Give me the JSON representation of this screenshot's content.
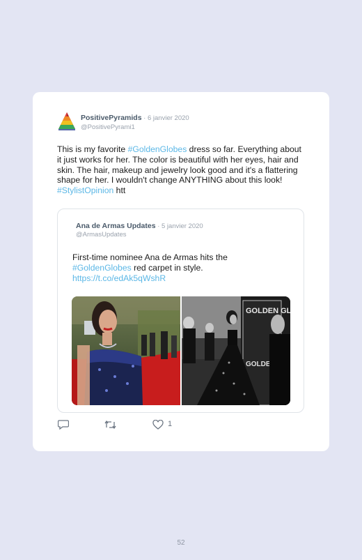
{
  "tweet": {
    "author_name": "PositivePyramids",
    "date": " · 6 janvier 2020",
    "handle": "@PositivePyrami1",
    "text_1": "This is my favorite ",
    "hashtag_1": "#GoldenGlobes",
    "text_2": " dress so far. Everything about it just works for her. The color is beautiful with her eyes, hair and skin. The hair, makeup and jewelry look good and it's a flattering shape for her. I wouldn't change ANYTHING about this look! ",
    "hashtag_2": "#StylistOpinion",
    "text_3": " htt"
  },
  "quoted": {
    "author_name": "Ana de Armas Updates",
    "date": " · 5 janvier 2020",
    "handle": "@ArmasUpdates",
    "text_1": "First-time nominee Ana de Armas hits the ",
    "hashtag": "#GoldenGlobes",
    "text_2": " red carpet in style.",
    "link": "https://t.co/edAk5qWshR",
    "signage_1": "GOLDEN GLOBE AWARDS",
    "signage_2": "GOLDEN GLOBE AWARDS"
  },
  "actions": {
    "reply_icon": "reply-icon",
    "retweet_icon": "retweet-icon",
    "like_icon": "heart-icon",
    "like_count": "1"
  },
  "page_number": "52",
  "colors": {
    "background": "#e3e5f3",
    "card": "#ffffff",
    "link": "#5bb7e6",
    "name": "#4a5a6a",
    "muted": "#9aa2ad"
  }
}
